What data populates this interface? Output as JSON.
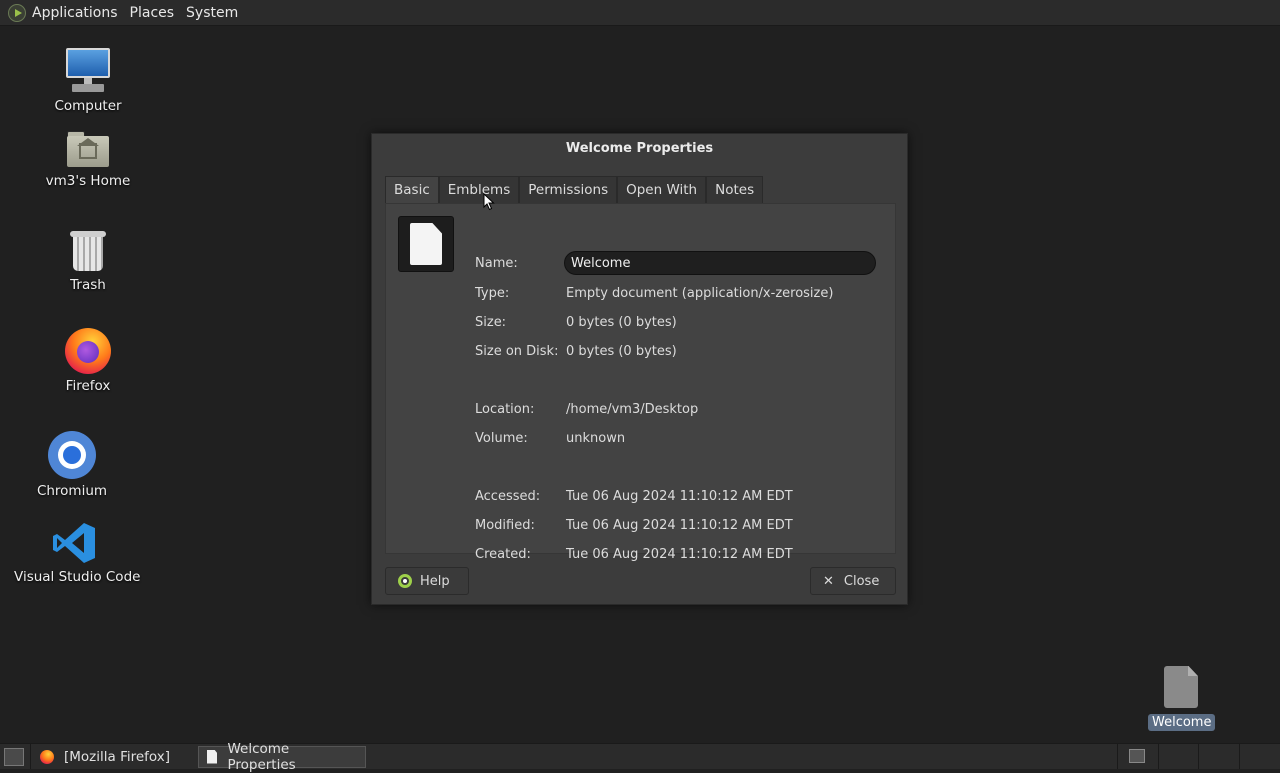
{
  "top_panel": {
    "menus": [
      "Applications",
      "Places",
      "System"
    ]
  },
  "desktop": {
    "icons": [
      {
        "label": "Computer",
        "icon": "computer-icon"
      },
      {
        "label": "vm3's Home",
        "icon": "home-folder-icon"
      },
      {
        "label": "Trash",
        "icon": "trash-icon"
      },
      {
        "label": "Firefox",
        "icon": "firefox-icon"
      },
      {
        "label": "Chromium",
        "icon": "chromium-icon"
      },
      {
        "label": "Visual Studio Code",
        "icon": "vscode-icon"
      }
    ],
    "file": {
      "label": "Welcome",
      "icon": "document-icon"
    }
  },
  "dialog": {
    "title": "Welcome Properties",
    "tabs": [
      "Basic",
      "Emblems",
      "Permissions",
      "Open With",
      "Notes"
    ],
    "active_tab": "Basic",
    "labels": {
      "name": "Name:",
      "type": "Type:",
      "size": "Size:",
      "size_on_disk": "Size on Disk:",
      "location": "Location:",
      "volume": "Volume:",
      "accessed": "Accessed:",
      "modified": "Modified:",
      "created": "Created:"
    },
    "values": {
      "name": "Welcome",
      "type": "Empty document (application/x-zerosize)",
      "size": "0 bytes (0 bytes)",
      "size_on_disk": "0 bytes (0 bytes)",
      "location": "/home/vm3/Desktop",
      "volume": "unknown",
      "accessed": "Tue 06 Aug 2024 11:10:12 AM EDT",
      "modified": "Tue 06 Aug 2024 11:10:12 AM EDT",
      "created": "Tue 06 Aug 2024 11:10:12 AM EDT"
    },
    "buttons": {
      "help": "Help",
      "close": "Close"
    }
  },
  "taskbar": {
    "tasks": [
      {
        "label": "[Mozilla Firefox]",
        "active": false
      },
      {
        "label": "Welcome Properties",
        "active": true
      }
    ]
  }
}
